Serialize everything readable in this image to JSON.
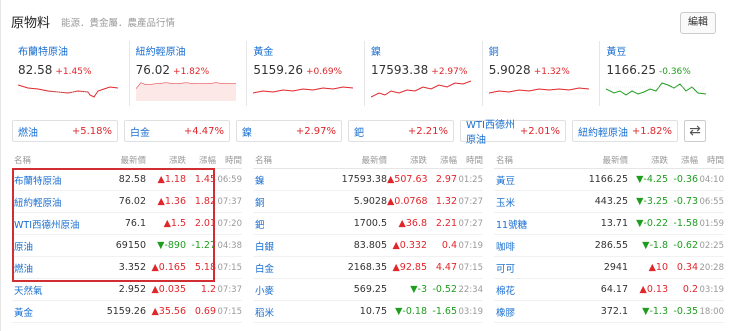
{
  "header": {
    "title": "原物料",
    "subtitle": "能源．貴金屬．農產品行情",
    "edit_label": "編輯"
  },
  "colors": {
    "up": "#e0262b",
    "down": "#1f9d1f",
    "link": "#1a6fd1",
    "highlight": "#d12e33"
  },
  "cards": [
    {
      "name": "布蘭特原油",
      "price": "82.58",
      "change": "+1.45%",
      "dir": "up"
    },
    {
      "name": "紐約輕原油",
      "price": "76.02",
      "change": "+1.82%",
      "dir": "up"
    },
    {
      "name": "黃金",
      "price": "5159.26",
      "change": "+0.69%",
      "dir": "up"
    },
    {
      "name": "鎳",
      "price": "17593.38",
      "change": "+2.97%",
      "dir": "up"
    },
    {
      "name": "銅",
      "price": "5.9028",
      "change": "+1.32%",
      "dir": "up"
    },
    {
      "name": "黃豆",
      "price": "1166.25",
      "change": "-0.36%",
      "dir": "down"
    }
  ],
  "chips": [
    {
      "name": "燃油",
      "change": "+5.18%"
    },
    {
      "name": "白金",
      "change": "+4.47%"
    },
    {
      "name": "鎳",
      "change": "+2.97%"
    },
    {
      "name": "鈀",
      "change": "+2.21%"
    },
    {
      "name": "WTI西德州原油",
      "change": "+2.01%"
    },
    {
      "name": "紐約輕原油",
      "change": "+1.82%"
    }
  ],
  "swap_icon": "⇄",
  "columns": {
    "name": "名稱",
    "price": "最新價",
    "change": "漲跌",
    "pct": "漲幅",
    "time": "時間"
  },
  "tables": [
    {
      "rows": [
        {
          "name": "布蘭特原油",
          "price": "82.58",
          "change": "▲1.18",
          "pct": "1.45",
          "time": "06:59",
          "dir": "up"
        },
        {
          "name": "紐約輕原油",
          "price": "76.02",
          "change": "▲1.36",
          "pct": "1.82",
          "time": "07:37",
          "dir": "up"
        },
        {
          "name": "WTI西德州原油",
          "price": "76.1",
          "change": "▲1.5",
          "pct": "2.01",
          "time": "07:20",
          "dir": "up"
        },
        {
          "name": "原油",
          "price": "69150",
          "change": "▼-890",
          "pct": "-1.27",
          "time": "04:38",
          "dir": "down"
        },
        {
          "name": "燃油",
          "price": "3.352",
          "change": "▲0.165",
          "pct": "5.18",
          "time": "07:15",
          "dir": "up"
        },
        {
          "name": "天然氣",
          "price": "2.952",
          "change": "▲0.035",
          "pct": "1.2",
          "time": "07:37",
          "dir": "up"
        },
        {
          "name": "黃金",
          "price": "5159.26",
          "change": "▲35.56",
          "pct": "0.69",
          "time": "07:15",
          "dir": "up"
        }
      ]
    },
    {
      "rows": [
        {
          "name": "鎳",
          "price": "17593.38",
          "change": "▲507.63",
          "pct": "2.97",
          "time": "01:25",
          "dir": "up"
        },
        {
          "name": "銅",
          "price": "5.9028",
          "change": "▲0.0768",
          "pct": "1.32",
          "time": "07:27",
          "dir": "up"
        },
        {
          "name": "鈀",
          "price": "1700.5",
          "change": "▲36.8",
          "pct": "2.21",
          "time": "07:27",
          "dir": "up"
        },
        {
          "name": "白銀",
          "price": "83.805",
          "change": "▲0.332",
          "pct": "0.4",
          "time": "07:19",
          "dir": "up"
        },
        {
          "name": "白金",
          "price": "2168.35",
          "change": "▲92.85",
          "pct": "4.47",
          "time": "07:15",
          "dir": "up"
        },
        {
          "name": "小麥",
          "price": "569.25",
          "change": "▼-3",
          "pct": "-0.52",
          "time": "22:34",
          "dir": "down"
        },
        {
          "name": "稻米",
          "price": "10.75",
          "change": "▼-0.18",
          "pct": "-1.65",
          "time": "03:19",
          "dir": "down"
        }
      ]
    },
    {
      "rows": [
        {
          "name": "黃豆",
          "price": "1166.25",
          "change": "▼-4.25",
          "pct": "-0.36",
          "time": "04:10",
          "dir": "down"
        },
        {
          "name": "玉米",
          "price": "443.25",
          "change": "▼-3.25",
          "pct": "-0.73",
          "time": "06:55",
          "dir": "down"
        },
        {
          "name": "11號糖",
          "price": "13.71",
          "change": "▼-0.22",
          "pct": "-1.58",
          "time": "01:59",
          "dir": "down"
        },
        {
          "name": "咖啡",
          "price": "286.55",
          "change": "▼-1.8",
          "pct": "-0.62",
          "time": "02:25",
          "dir": "down"
        },
        {
          "name": "可可",
          "price": "2941",
          "change": "▲10",
          "pct": "0.34",
          "time": "20:28",
          "dir": "up"
        },
        {
          "name": "棉花",
          "price": "64.17",
          "change": "▲0.13",
          "pct": "0.2",
          "time": "03:19",
          "dir": "up"
        },
        {
          "name": "橡膠",
          "price": "372.1",
          "change": "▼-1.3",
          "pct": "-0.35",
          "time": "18:00",
          "dir": "down"
        }
      ]
    }
  ]
}
